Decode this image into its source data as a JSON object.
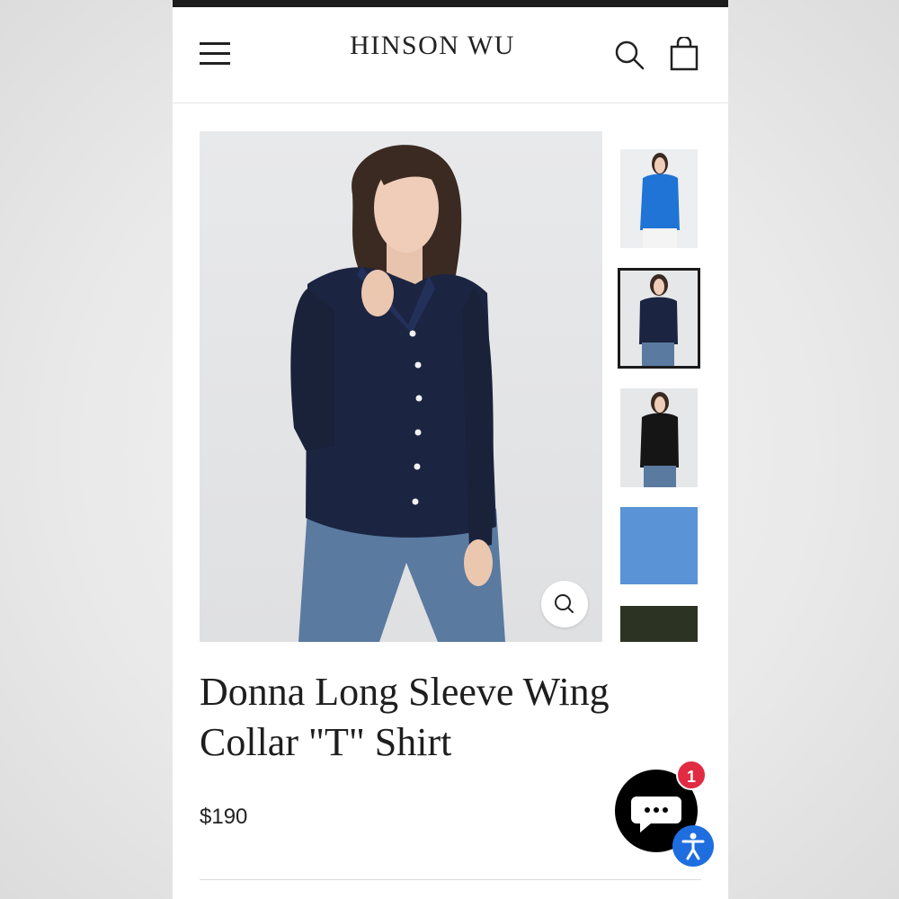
{
  "header": {
    "brand": "HINSON WU",
    "icons": [
      "hamburger-menu-icon",
      "search-icon",
      "shopping-bag-icon"
    ]
  },
  "product": {
    "title_line1": "Donna Long Sleeve Wing",
    "title_line2": "Collar \"T\" Shirt",
    "price": "$190"
  },
  "gallery": {
    "thumbnails": [
      "blue shirt",
      "navy shirt",
      "black shirt",
      "blue swatch",
      "olive swatch"
    ],
    "selected_index": 1
  },
  "chat": {
    "badge_count": "1"
  },
  "colors": {
    "navy": "#1b2440",
    "blue": "#1f74d6",
    "swatch_blue": "#5a93d6",
    "swatch_olive": "#2d3322",
    "badge": "#e02b43",
    "a11y": "#1f6ee0"
  }
}
